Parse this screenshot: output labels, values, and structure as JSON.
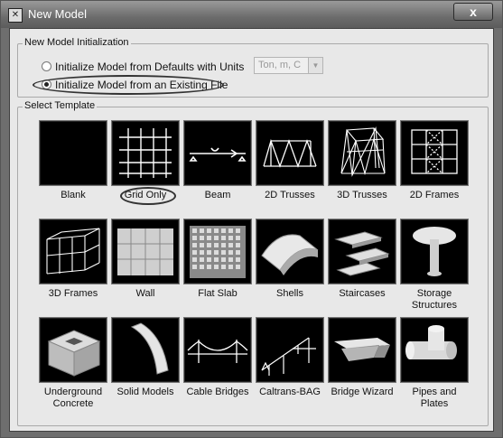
{
  "window": {
    "title": "New Model",
    "close_label": "x"
  },
  "init_group": {
    "legend": "New Model Initialization",
    "options": [
      {
        "label": "Initialize Model from Defaults with Units",
        "selected": false
      },
      {
        "label": "Initialize Model  from an Existing File",
        "selected": true
      }
    ],
    "units": {
      "value": "Ton, m, C"
    }
  },
  "template_group": {
    "legend": "Select Template",
    "templates": [
      {
        "label": "Blank",
        "icon": "blank-template-icon"
      },
      {
        "label": "Grid Only",
        "icon": "grid-only-template-icon"
      },
      {
        "label": "Beam",
        "icon": "beam-template-icon"
      },
      {
        "label": "2D Trusses",
        "icon": "2d-trusses-template-icon"
      },
      {
        "label": "3D Trusses",
        "icon": "3d-trusses-template-icon"
      },
      {
        "label": "2D Frames",
        "icon": "2d-frames-template-icon"
      },
      {
        "label": "3D Frames",
        "icon": "3d-frames-template-icon"
      },
      {
        "label": "Wall",
        "icon": "wall-template-icon"
      },
      {
        "label": "Flat Slab",
        "icon": "flat-slab-template-icon"
      },
      {
        "label": "Shells",
        "icon": "shells-template-icon"
      },
      {
        "label": "Staircases",
        "icon": "staircases-template-icon"
      },
      {
        "label": "Storage Structures",
        "icon": "storage-structures-template-icon"
      },
      {
        "label": "Underground Concrete",
        "icon": "underground-concrete-template-icon"
      },
      {
        "label": "Solid Models",
        "icon": "solid-models-template-icon"
      },
      {
        "label": "Cable Bridges",
        "icon": "cable-bridges-template-icon"
      },
      {
        "label": "Caltrans-BAG",
        "icon": "caltrans-bag-template-icon"
      },
      {
        "label": "Bridge Wizard",
        "icon": "bridge-wizard-template-icon"
      },
      {
        "label": "Pipes and Plates",
        "icon": "pipes-and-plates-template-icon"
      }
    ]
  }
}
